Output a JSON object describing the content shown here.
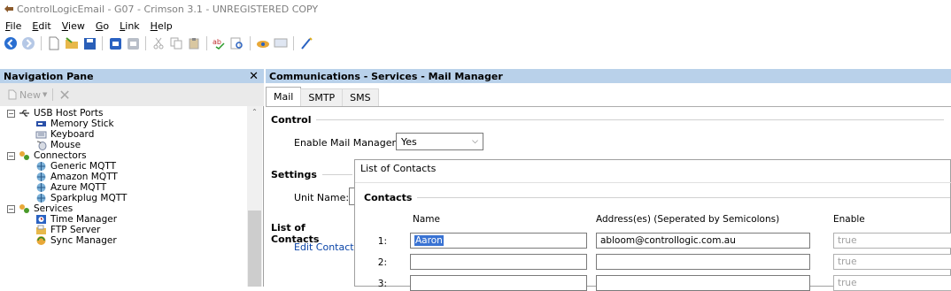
{
  "window": {
    "title": "ControlLogicEmail - G07 - Crimson 3.1 - UNREGISTERED COPY"
  },
  "menu": [
    {
      "label": "File",
      "key": "F",
      "rest": "ile"
    },
    {
      "label": "Edit",
      "key": "E",
      "rest": "dit"
    },
    {
      "label": "View",
      "key": "V",
      "rest": "iew"
    },
    {
      "label": "Go",
      "key": "G",
      "rest": "o"
    },
    {
      "label": "Link",
      "key": "L",
      "rest": "ink"
    },
    {
      "label": "Help",
      "key": "H",
      "rest": "elp"
    }
  ],
  "toolbar": {
    "icons": [
      "back-icon",
      "forward-icon",
      "new-file-icon",
      "open-folder-icon",
      "save-icon",
      "blue-box-icon",
      "gray-box-icon",
      "cut-icon",
      "copy-icon",
      "paste-icon",
      "spell-check-icon",
      "find-icon",
      "send-icon",
      "monitor-icon",
      "wand-icon"
    ]
  },
  "nav": {
    "title": "Navigation Pane",
    "new_label": "New",
    "tree": [
      {
        "label": "USB Host Ports",
        "icon": "usb-icon",
        "level": 0,
        "expander": "⊟"
      },
      {
        "label": "Memory Stick",
        "icon": "memory-stick-icon",
        "level": 1
      },
      {
        "label": "Keyboard",
        "icon": "keyboard-icon",
        "level": 1
      },
      {
        "label": "Mouse",
        "icon": "mouse-icon",
        "level": 1
      },
      {
        "label": "Connectors",
        "icon": "connectors-icon",
        "level": 0,
        "expander": "⊟"
      },
      {
        "label": "Generic MQTT",
        "icon": "mqtt-icon",
        "level": 1
      },
      {
        "label": "Amazon MQTT",
        "icon": "mqtt-icon",
        "level": 1
      },
      {
        "label": "Azure MQTT",
        "icon": "mqtt-icon",
        "level": 1
      },
      {
        "label": "Sparkplug MQTT",
        "icon": "mqtt-icon",
        "level": 1
      },
      {
        "label": "Services",
        "icon": "services-icon",
        "level": 0,
        "expander": "⊟"
      },
      {
        "label": "Time Manager",
        "icon": "time-manager-icon",
        "level": 1
      },
      {
        "label": "FTP Server",
        "icon": "ftp-server-icon",
        "level": 1
      },
      {
        "label": "Sync Manager",
        "icon": "sync-manager-icon",
        "level": 1
      }
    ]
  },
  "main": {
    "title": "Communications - Services - Mail Manager",
    "tabs": [
      "Mail",
      "SMTP",
      "SMS"
    ],
    "active_tab": "Mail",
    "control": {
      "group": "Control",
      "enable_label": "Enable Mail Manager:",
      "enable_value": "Yes"
    },
    "settings": {
      "group": "Settings",
      "unit_name_label": "Unit Name:"
    },
    "contacts_section": {
      "group": "List of Contacts",
      "edit_link": "Edit Contacts"
    }
  },
  "dialog": {
    "title": "List of Contacts",
    "group": "Contacts",
    "columns": {
      "name": "Name",
      "address": "Address(es) (Seperated by Semicolons)",
      "enable": "Enable"
    },
    "rows": [
      {
        "num": "1:",
        "name": "Aaron",
        "address": "abloom@controllogic.com.au",
        "enable": "true"
      },
      {
        "num": "2:",
        "name": "",
        "address": "",
        "enable": "true"
      },
      {
        "num": "3:",
        "name": "",
        "address": "",
        "enable": "true"
      }
    ]
  }
}
